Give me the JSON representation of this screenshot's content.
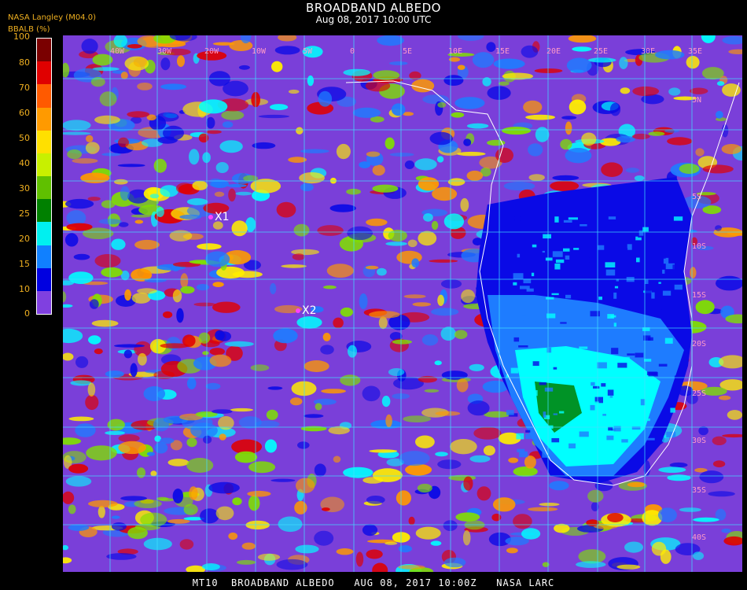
{
  "header": {
    "title": "BROADBAND ALBEDO",
    "subtitle": "Aug 08, 2017 10:00 UTC",
    "source": "NASA Langley (M04.0)"
  },
  "legend": {
    "title": "BBALB (%)",
    "ticks": [
      "100",
      "80",
      "70",
      "60",
      "50",
      "40",
      "30",
      "25",
      "20",
      "15",
      "10",
      "0"
    ],
    "colors": [
      "#7a0000",
      "#e00000",
      "#ff5a00",
      "#ff9a00",
      "#ffe000",
      "#c8f000",
      "#60c000",
      "#008000",
      "#00f0f0",
      "#1080ff",
      "#0000e0",
      "#8040e0"
    ]
  },
  "map": {
    "lon_labels": [
      "40W",
      "30W",
      "20W",
      "10W",
      "5W",
      "0",
      "5E",
      "10E",
      "15E",
      "20E",
      "25E",
      "30E",
      "35E"
    ],
    "lat_labels": [
      "5N",
      "5S",
      "10S",
      "15S",
      "20S",
      "25S",
      "30S",
      "35S",
      "40S"
    ],
    "markers": [
      {
        "label": "X1"
      },
      {
        "label": "X2"
      }
    ],
    "colors": {
      "low": "#7a3fd9",
      "blue": "#0a0ae6",
      "lightblue": "#1e7cff",
      "cyan": "#00ffff",
      "green": "#008000",
      "lime": "#7fe000",
      "yellow": "#ffee00",
      "orange": "#ff9a00",
      "red": "#e00000",
      "grid": "#40e0ff",
      "coast": "#ffffff"
    }
  },
  "footer": "MT10  BROADBAND ALBEDO   AUG 08, 2017 10:00Z   NASA LARC"
}
